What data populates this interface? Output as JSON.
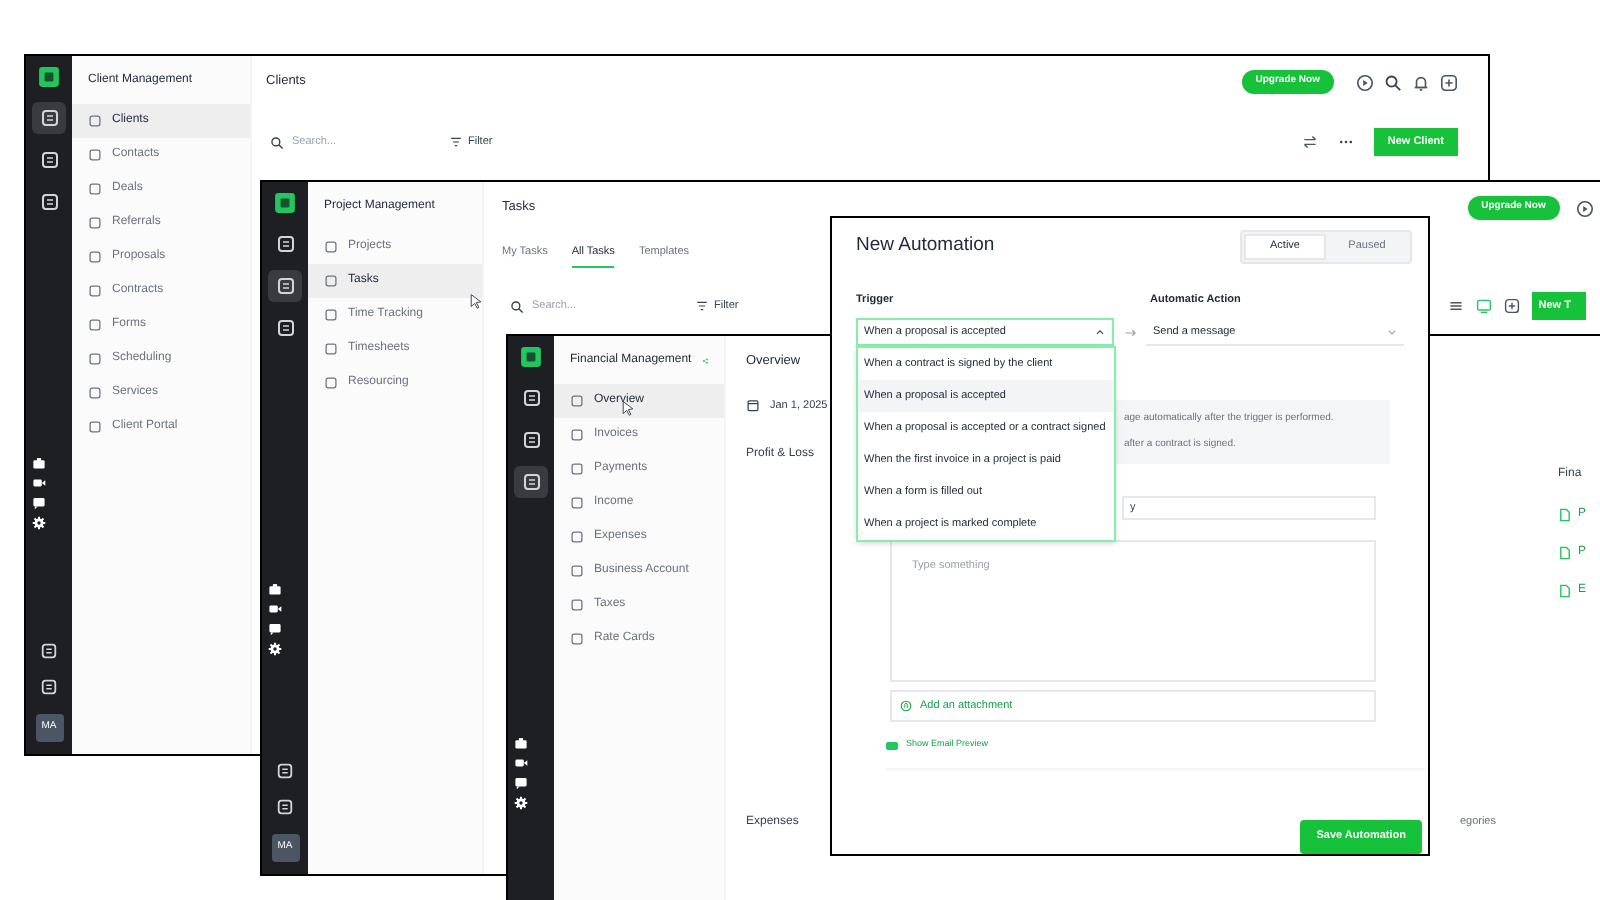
{
  "client_window": {
    "rail": {
      "items": [
        {
          "selected": true
        },
        {
          "selected": false
        },
        {
          "selected": false
        }
      ],
      "avatar": "MA"
    },
    "sidebar_title": "Client Management",
    "sidebar_items": [
      {
        "label": "Clients",
        "selected": true
      },
      {
        "label": "Contacts",
        "selected": false
      },
      {
        "label": "Deals",
        "selected": false
      },
      {
        "label": "Referrals",
        "selected": false
      },
      {
        "label": "Proposals",
        "selected": false
      },
      {
        "label": "Contracts",
        "selected": false
      },
      {
        "label": "Forms",
        "selected": false
      },
      {
        "label": "Scheduling",
        "selected": false
      },
      {
        "label": "Services",
        "selected": false
      },
      {
        "label": "Client Portal",
        "selected": false
      }
    ],
    "title": "Clients",
    "upgrade_button": "Upgrade Now",
    "search": {
      "placeholder": "Search..."
    },
    "filter_button": "Filter",
    "new_button": "New Client"
  },
  "project_window": {
    "rail": {
      "items": [
        {
          "selected": false
        },
        {
          "selected": true
        },
        {
          "selected": false
        }
      ],
      "avatar": "MA"
    },
    "sidebar_title": "Project Management",
    "sidebar_items": [
      {
        "label": "Projects",
        "selected": false
      },
      {
        "label": "Tasks",
        "selected": true
      },
      {
        "label": "Time Tracking",
        "selected": false
      },
      {
        "label": "Timesheets",
        "selected": false
      },
      {
        "label": "Resourcing",
        "selected": false
      }
    ],
    "title": "Tasks",
    "tabs": [
      {
        "label": "My Tasks",
        "selected": false
      },
      {
        "label": "All Tasks",
        "selected": true
      },
      {
        "label": "Templates",
        "selected": false
      }
    ],
    "upgrade_button": "Upgrade Now",
    "search": {
      "placeholder": "Search..."
    },
    "filter_button": "Filter",
    "new_button": "New T"
  },
  "finance_window": {
    "rail": {
      "items": [
        {
          "selected": false
        },
        {
          "selected": false
        },
        {
          "selected": true
        }
      ]
    },
    "sidebar_title": "Financial Management",
    "sidebar_items": [
      {
        "label": "Overview",
        "selected": true
      },
      {
        "label": "Invoices",
        "selected": false
      },
      {
        "label": "Payments",
        "selected": false
      },
      {
        "label": "Income",
        "selected": false
      },
      {
        "label": "Expenses",
        "selected": false
      },
      {
        "label": "Business Account",
        "selected": false
      },
      {
        "label": "Taxes",
        "selected": false
      },
      {
        "label": "Rate Cards",
        "selected": false
      }
    ],
    "title": "Overview",
    "date": "Jan 1, 2025",
    "sections": [
      "Profit & Loss",
      "Expenses"
    ],
    "column_label": "egories",
    "side_heading": "Fina",
    "side_links": [
      "P",
      "P",
      "E"
    ]
  },
  "automation_modal": {
    "title": "New Automation",
    "status_options": [
      {
        "label": "Active",
        "selected": true
      },
      {
        "label": "Paused",
        "selected": false
      }
    ],
    "trigger_label": "Trigger",
    "action_label": "Automatic Action",
    "trigger_select": {
      "value": "When a proposal is accepted",
      "expanded": true
    },
    "action_select": {
      "value": "Send a message"
    },
    "trigger_options": [
      {
        "label": "When a contract is signed by the client",
        "selected": false
      },
      {
        "label": "When a proposal is accepted",
        "selected": true
      },
      {
        "label": "When a proposal is accepted or a contract signed",
        "selected": false
      },
      {
        "label": "When the first invoice in a project is paid",
        "selected": false
      },
      {
        "label": "When a form is filled out",
        "selected": false
      },
      {
        "label": "When a project is marked complete",
        "selected": false
      }
    ],
    "info_lines": [
      "age automatically after the trigger is performed.",
      "after a contract is signed."
    ],
    "subject_field": {
      "value": "y"
    },
    "message_field": {
      "placeholder": "Type something"
    },
    "attachment_link": "Add an attachment",
    "email_preview": {
      "label": "Show Email Preview",
      "on": true
    },
    "save_button": "Save Automation"
  }
}
